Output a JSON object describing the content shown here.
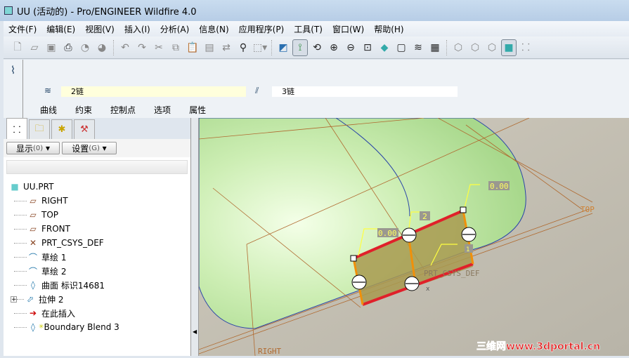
{
  "window": {
    "title": "UU (活动的) - Pro/ENGINEER Wildfire 4.0"
  },
  "menu": [
    "文件(F)",
    "编辑(E)",
    "视图(V)",
    "插入(I)",
    "分析(A)",
    "信息(N)",
    "应用程序(P)",
    "工具(T)",
    "窗口(W)",
    "帮助(H)"
  ],
  "toolbar": {
    "icons": [
      "new-icon",
      "open-icon",
      "save-icon",
      "print-icon",
      "email-icon",
      "email-link-icon",
      "undo-icon",
      "redo-icon",
      "cut-icon",
      "copy-icon",
      "paste-icon",
      "paste-special-icon",
      "regenerate-icon",
      "find-icon",
      "select-box-icon",
      "repaint-icon",
      "spin-center-icon",
      "orient-icon",
      "zoom-in-icon",
      "zoom-out-icon",
      "refit-icon",
      "reorient-icon",
      "saved-views-icon",
      "layers-icon",
      "view-manager-icon",
      "wireframe-icon",
      "hidden-line-icon",
      "no-hidden-icon",
      "shading-icon",
      "model-tree-icon"
    ]
  },
  "dashboard": {
    "first_direction": "2链",
    "second_direction": "3链",
    "tabs": [
      "曲线",
      "约束",
      "控制点",
      "选项",
      "属性"
    ]
  },
  "model_tree": {
    "show_button": "显示",
    "show_key": "(0)",
    "settings_button": "设置",
    "settings_key": "(G)",
    "items": [
      {
        "label": "UU.PRT",
        "icon": "part-icon"
      },
      {
        "label": "RIGHT",
        "icon": "datum-plane-icon"
      },
      {
        "label": "TOP",
        "icon": "datum-plane-icon"
      },
      {
        "label": "FRONT",
        "icon": "datum-plane-icon"
      },
      {
        "label": "PRT_CSYS_DEF",
        "icon": "csys-icon"
      },
      {
        "label": "草绘 1",
        "icon": "sketch-icon"
      },
      {
        "label": "草绘 2",
        "icon": "sketch-icon"
      },
      {
        "label": "曲面 标识14681",
        "icon": "surface-icon"
      },
      {
        "label": "拉伸 2",
        "icon": "extrude-icon"
      },
      {
        "label": "在此插入",
        "icon": "insert-here-arrow-icon"
      },
      {
        "label": "Boundary Blend 3",
        "icon": "boundary-blend-icon"
      }
    ]
  },
  "viewport": {
    "labels": {
      "top": "TOP",
      "right": "RIGHT",
      "csys": "PRT_CSYS_DEF",
      "x": "x",
      "dim1": "0.00",
      "dim2": "0.00",
      "tag2": "2",
      "tag1": "1"
    },
    "watermark": "三维网www.3dportal.cn"
  },
  "colors": {
    "surface": "#c8eab0",
    "background": "#bcb8ac",
    "edge_red": "#e0202a",
    "edge_orange": "#f0900a",
    "datum": "#c87832"
  }
}
